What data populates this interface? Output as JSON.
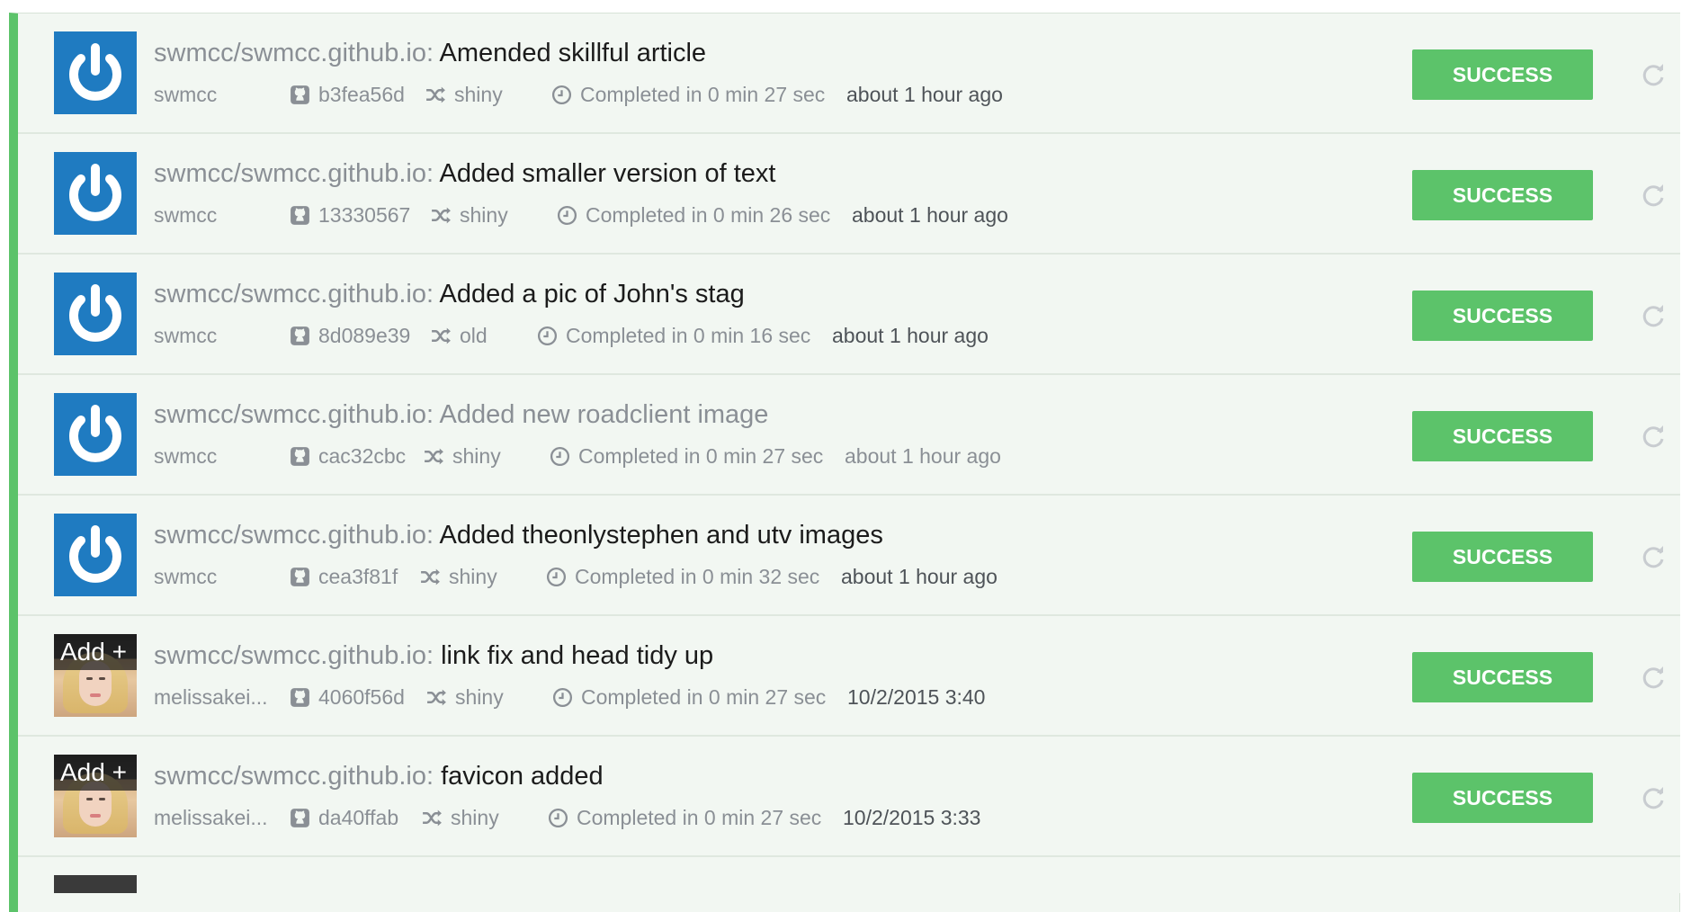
{
  "builds": [
    {
      "avatar": "power-avatar",
      "repo": "swmcc/swmcc.github.io:",
      "message": "Amended skillful article",
      "author": "swmcc",
      "commit": "b3fea56d",
      "branch": "shiny",
      "duration": "Completed in 0 min 27 sec",
      "time": "about 1 hour ago",
      "status": "SUCCESS"
    },
    {
      "avatar": "power-avatar",
      "repo": "swmcc/swmcc.github.io:",
      "message": "Added smaller version of text",
      "author": "swmcc",
      "commit": "13330567",
      "branch": "shiny",
      "duration": "Completed in 0 min 26 sec",
      "time": "about 1 hour ago",
      "status": "SUCCESS"
    },
    {
      "avatar": "power-avatar",
      "repo": "swmcc/swmcc.github.io:",
      "message": "Added a pic of John's stag",
      "author": "swmcc",
      "commit": "8d089e39",
      "branch": "old",
      "duration": "Completed in 0 min 16 sec",
      "time": "about 1 hour ago",
      "status": "SUCCESS"
    },
    {
      "avatar": "power-avatar",
      "repo": "swmcc/swmcc.github.io:",
      "message": "Added new roadclient image",
      "author": "swmcc",
      "commit": "cac32cbc",
      "branch": "shiny",
      "duration": "Completed in 0 min 27 sec",
      "time": "about 1 hour ago",
      "status": "SUCCESS"
    },
    {
      "avatar": "power-avatar",
      "repo": "swmcc/swmcc.github.io:",
      "message": "Added theonlystephen and utv images",
      "author": "swmcc",
      "commit": "cea3f81f",
      "branch": "shiny",
      "duration": "Completed in 0 min 32 sec",
      "time": "about 1 hour ago",
      "status": "SUCCESS"
    },
    {
      "avatar": "photo-avatar",
      "avatar_overlay": "Add +",
      "repo": "swmcc/swmcc.github.io:",
      "message": "link fix and head tidy up",
      "author": "melissakei...",
      "commit": "4060f56d",
      "branch": "shiny",
      "duration": "Completed in 0 min 27 sec",
      "time": "10/2/2015 3:40",
      "status": "SUCCESS"
    },
    {
      "avatar": "photo-avatar",
      "avatar_overlay": "Add +",
      "repo": "swmcc/swmcc.github.io:",
      "message": "favicon added",
      "author": "melissakei...",
      "commit": "da40ffab",
      "branch": "shiny",
      "duration": "Completed in 0 min 27 sec",
      "time": "10/2/2015 3:33",
      "status": "SUCCESS"
    }
  ],
  "icons": {
    "commit": "github-icon",
    "branch": "shuffle-branch-icon",
    "duration": "clock-icon",
    "action": "refresh-icon"
  },
  "colors": {
    "success": "#5cc36a",
    "avatar_blue": "#1f7bc1",
    "row_background": "#f2f7f2"
  }
}
